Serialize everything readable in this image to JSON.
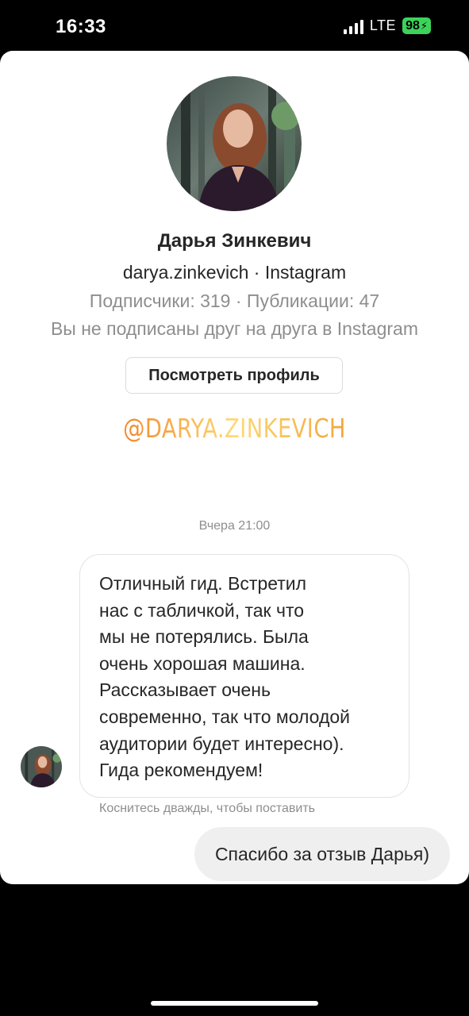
{
  "status_bar": {
    "time": "16:33",
    "network": "LTE",
    "battery": "98",
    "battery_color": "#3cd35a"
  },
  "profile": {
    "name": "Дарья Зинкевич",
    "handle": "darya.zinkevich · Instagram",
    "stats": "Подписчики: 319 · Публикации: 47",
    "follow_status": "Вы не подписаны друг на друга в Instagram",
    "view_profile_label": "Посмотреть профиль",
    "avatar_icon": "profile-photo"
  },
  "sticker": {
    "text": "@DARYA.ZINKEVICH",
    "colors": [
      "#f58529",
      "#feda77",
      "#f1a43a"
    ]
  },
  "conversation": {
    "timestamp": "Вчера 21:00",
    "incoming_message_lines": [
      "Отличный гид. Встретил",
      "нас с табличкой, так что",
      "мы не потерялись. Была",
      "очень хорошая машина.",
      "Рассказывает очень",
      "современно, так что молодой",
      "аудитории будет интересно).",
      "Гида рекомендуем!"
    ],
    "reaction_hint": "Коснитесь дважды, чтобы поставить",
    "outgoing_message": "Спасибо за отзыв Дарья)"
  },
  "colors": {
    "text_primary": "#262626",
    "text_secondary": "#8e8e8e",
    "outgoing_bubble": "#efefef",
    "border": "#dbdbdb"
  }
}
